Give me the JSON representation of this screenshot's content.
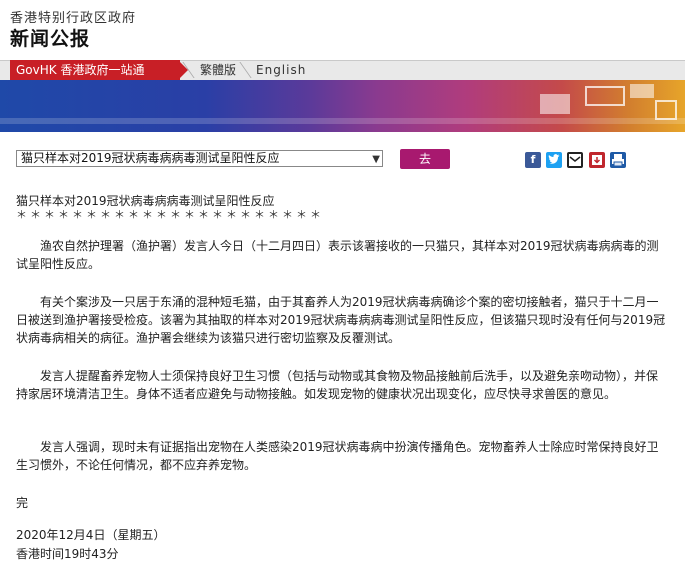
{
  "header": {
    "government_name": "香港特别行政区政府",
    "site_title": "新闻公报"
  },
  "nav": {
    "gov_portal": "GovHK 香港政府一站通",
    "traditional": "繁體版",
    "english": "English"
  },
  "selector": {
    "selected": "猫只样本对2019冠状病毒病病毒测试呈阳性反应",
    "go_label": "去"
  },
  "share": {
    "icons": [
      "facebook-icon",
      "twitter-icon",
      "email-icon",
      "download-icon",
      "print-icon"
    ],
    "colors": {
      "facebook": "#3b5998",
      "twitter": "#1da1f2",
      "email": "#222222",
      "download": "#c0272d",
      "print": "#1f5aa6"
    }
  },
  "article": {
    "title": "猫只样本对2019冠状病毒病病毒测试呈阳性反应",
    "stars": "＊＊＊＊＊＊＊＊＊＊＊＊＊＊＊＊＊＊＊＊＊＊",
    "paragraphs": [
      "渔农自然护理署（渔护署）发言人今日（十二月四日）表示该署接收的一只猫只，其样本对2019冠状病毒病病毒的测试呈阳性反应。",
      "有关个案涉及一只居于东涌的混种短毛猫，由于其畜养人为2019冠状病毒病确诊个案的密切接触者，猫只于十二月一日被送到渔护署接受检疫。该署为其抽取的样本对2019冠状病毒病病毒测试呈阳性反应，但该猫只现时没有任何与2019冠状病毒病相关的病征。渔护署会继续为该猫只进行密切监察及反覆测试。",
      "发言人提醒畜养宠物人士须保持良好卫生习惯（包括与动物或其食物及物品接触前后洗手，以及避免亲吻动物），并保持家居环境清洁卫生。身体不适者应避免与动物接触。如发现宠物的健康状况出现变化，应尽快寻求兽医的意见。",
      "发言人强调，现时未有证据指出宠物在人类感染2019冠状病毒病中扮演传播角色。宠物畜养人士除应时常保持良好卫生习惯外，不论任何情况，都不应弃养宠物。"
    ],
    "end": "完",
    "date": "2020年12月4日（星期五）",
    "time": "香港时间19时43分"
  },
  "colors": {
    "gov_red": "#c81f26",
    "go_button": "#a8196f"
  }
}
